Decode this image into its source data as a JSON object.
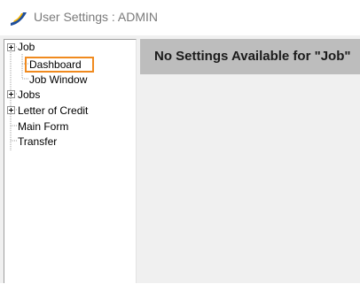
{
  "window": {
    "title": "User Settings : ADMIN",
    "icon": "app-logo-icon"
  },
  "tree": {
    "items": [
      {
        "label": "Job",
        "expandable": true,
        "expanded": false,
        "level": 0
      },
      {
        "label": "Dashboard",
        "expandable": false,
        "selected": true,
        "level": 1
      },
      {
        "label": "Job Window",
        "expandable": false,
        "level": 1
      },
      {
        "label": "Jobs",
        "expandable": true,
        "expanded": false,
        "level": 0
      },
      {
        "label": "Letter of Credit",
        "expandable": true,
        "expanded": false,
        "level": 0
      },
      {
        "label": "Main Form",
        "expandable": false,
        "level": 0
      },
      {
        "label": "Transfer",
        "expandable": false,
        "level": 0
      }
    ]
  },
  "panel": {
    "message": "No Settings Available for \"Job\""
  },
  "colors": {
    "selection_outline": "#f08a1e",
    "panel_header_bg": "#bdbdbd",
    "title_text": "#7a7a7a"
  }
}
